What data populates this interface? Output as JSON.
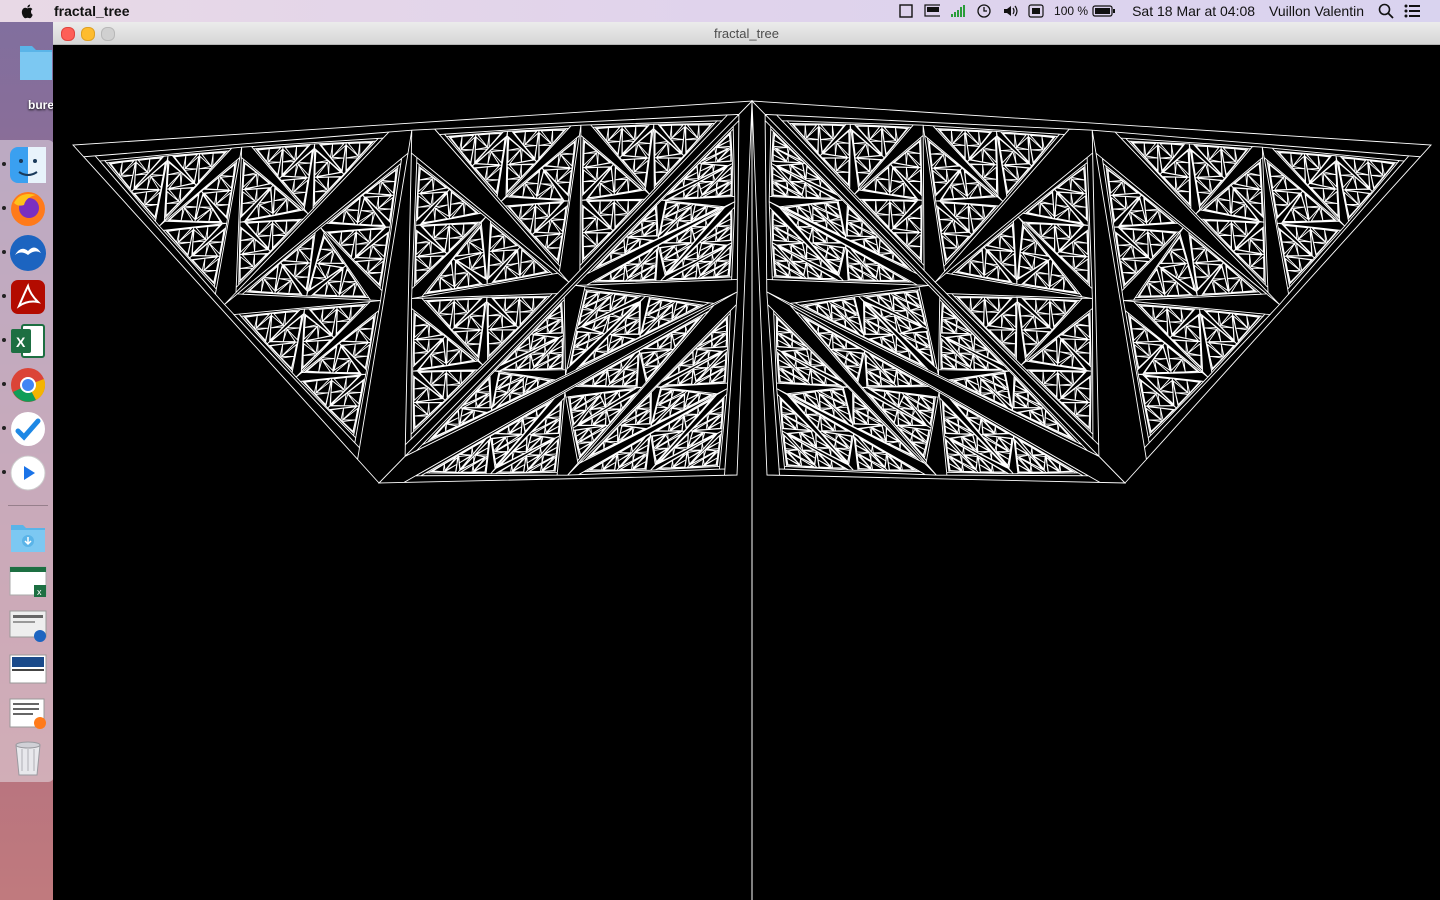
{
  "menubar": {
    "app_name": "fractal_tree",
    "battery": "100 %",
    "datetime": "Sat 18 Mar at  04:08",
    "user": "Vuillon Valentin"
  },
  "desktop": {
    "folder_label": "bure"
  },
  "window": {
    "title": "fractal_tree"
  },
  "dock": {
    "apps": [
      "Finder",
      "Firefox",
      "OpenOffice",
      "Acrobat Reader",
      "Excel",
      "Chrome",
      "Toolbox",
      "QuickTime"
    ],
    "others": [
      "Downloads",
      "Excel document",
      "Document preview",
      "Screenshot",
      "Firefox document",
      "Trash"
    ]
  },
  "fractal": {
    "line_color": "#ffffff",
    "background_color": "#000000"
  }
}
